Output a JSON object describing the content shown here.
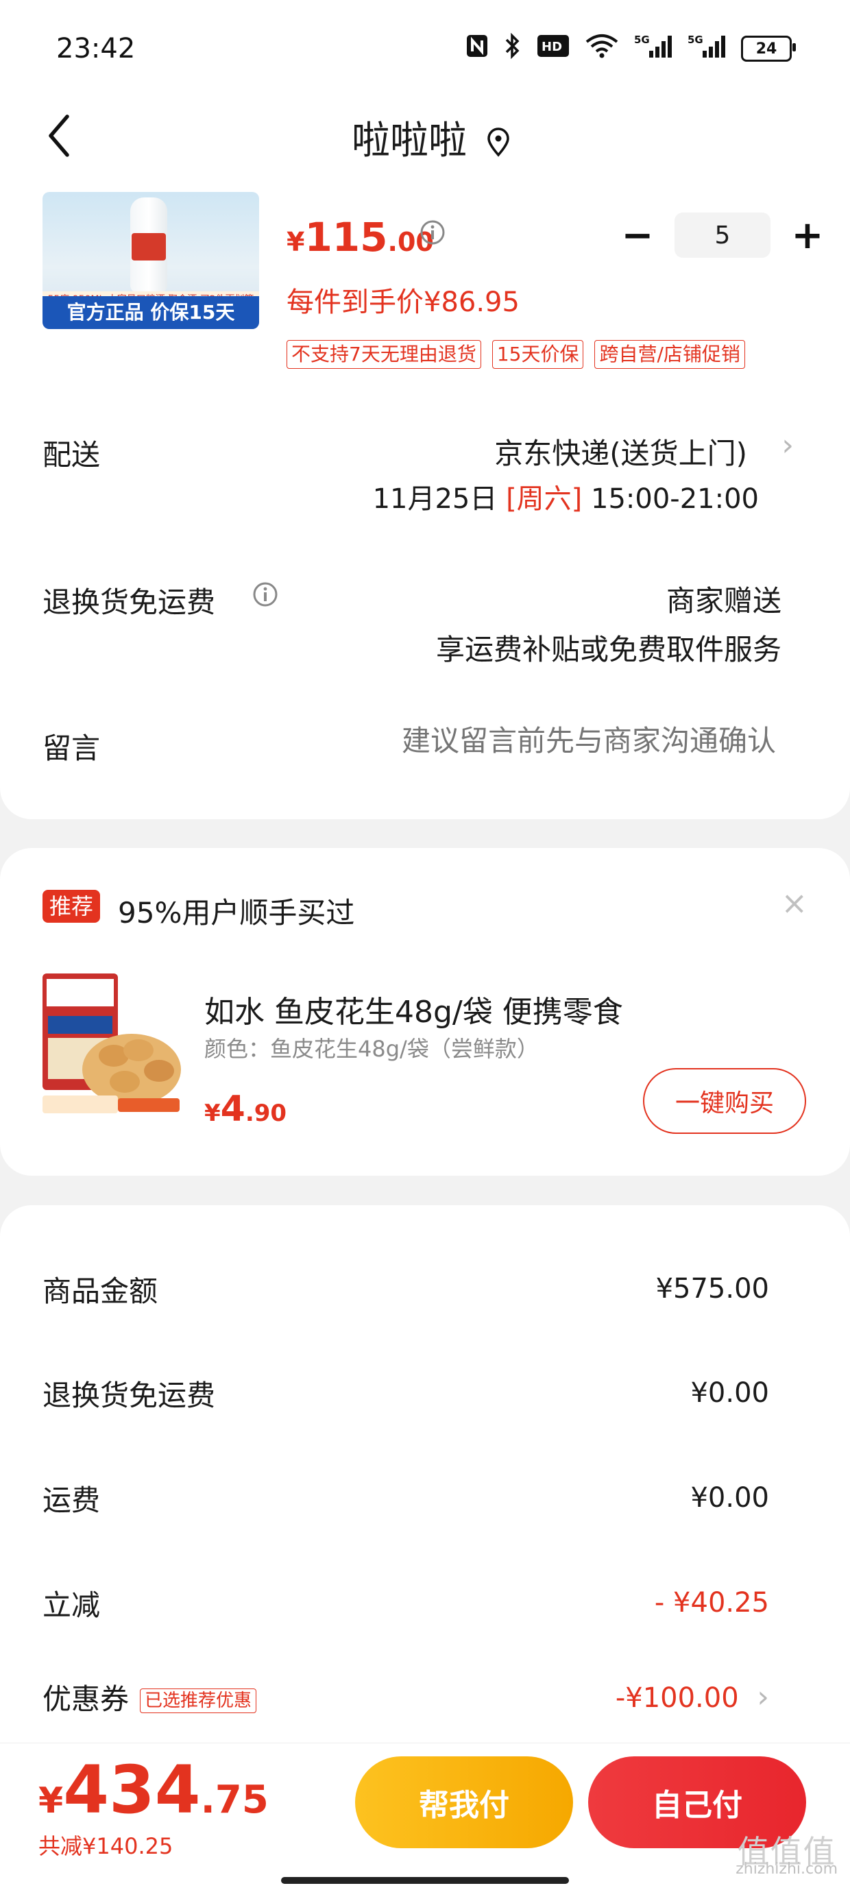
{
  "status_bar": {
    "time": "23:42",
    "icons": [
      "nfc-icon",
      "bluetooth-icon",
      "hd-icon",
      "wifi-icon",
      "signal-5g-icon",
      "signal-5g-icon"
    ],
    "battery": "24"
  },
  "header": {
    "title": "啦啦啦"
  },
  "product": {
    "thumb_tag": "55度 950ML 大容量口粮酒 聚会酒 买2件更划算",
    "thumb_banner": "官方正品  价保15天",
    "price_currency": "¥",
    "price_int": "115",
    "price_dec": ".00",
    "quantity": "5",
    "each_price": "每件到手价¥86.95",
    "tags": [
      "不支持7天无理由退货",
      "15天价保",
      "跨自营/店铺促销"
    ]
  },
  "delivery": {
    "label": "配送",
    "method": "京东快递(送货上门)",
    "date": "11月25日 ",
    "weekday": "[周六]",
    "time_range": " 15:00-21:00"
  },
  "return_fee": {
    "label": "退换货免运费",
    "value1": "商家赠送",
    "value2": "享运费补贴或免费取件服务"
  },
  "message": {
    "label": "留言",
    "placeholder": "建议留言前先与商家沟通确认"
  },
  "recommend": {
    "badge": "推荐",
    "text": "95%用户顺手买过",
    "close": "×",
    "product_name": "如水 鱼皮花生48g/袋 便携零食",
    "spec": "颜色：鱼皮花生48g/袋（尝鲜款）",
    "price_currency": "¥",
    "price_int": "4",
    "price_dec": ".90",
    "buy_label": "一键购买"
  },
  "summary": {
    "rows": [
      {
        "label": "商品金额",
        "value": "¥575.00"
      },
      {
        "label": "退换货免运费",
        "value": "¥0.00"
      },
      {
        "label": "运费",
        "value": "¥0.00"
      },
      {
        "label": "立减",
        "value": "- ¥40.25"
      },
      {
        "label": "优惠券",
        "badge": "已选推荐优惠",
        "value": "-¥100.00"
      }
    ]
  },
  "bottom": {
    "total_currency": "¥",
    "total_int": "434",
    "total_dec": ".75",
    "saved": "共减¥140.25",
    "help_pay": "帮我付",
    "self_pay": "自己付"
  },
  "watermark": {
    "mark": "值值值",
    "url": "zhizhizhi.com"
  },
  "colors": {
    "accent_red": "#e3331f",
    "help_yellow": "#fdc220",
    "self_red": "#ef3a3e"
  }
}
